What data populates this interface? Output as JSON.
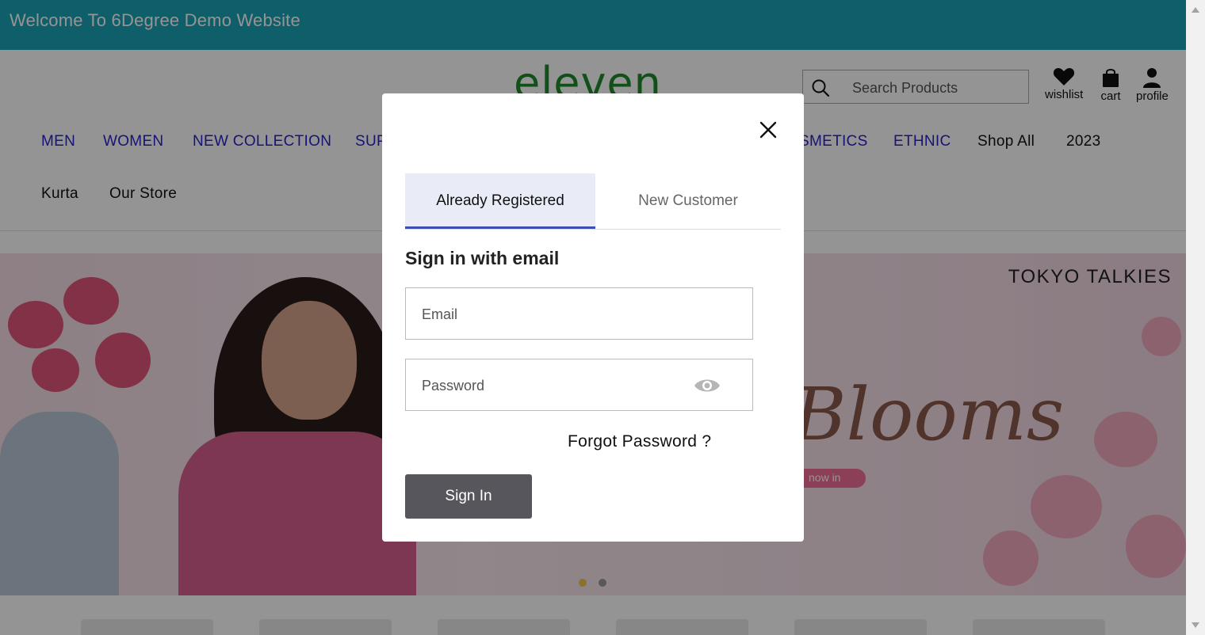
{
  "announcement": "Welcome To 6Degree Demo Website",
  "logo": "eleven",
  "search": {
    "placeholder": "Search Products"
  },
  "header_icons": {
    "wishlist": "wishlist",
    "cart": "cart",
    "profile": "profile"
  },
  "nav": {
    "items": [
      "MEN",
      "WOMEN",
      "NEW COLLECTION",
      "SUP",
      "SMETICS",
      "ETHNIC",
      "Shop All",
      "2023",
      "Kurta",
      "Our Store"
    ]
  },
  "banner": {
    "brand": "TOKYO TALKIES",
    "headline": "Blooms",
    "cta": "now in"
  },
  "carousel": {
    "slides": 2,
    "active_index": 0,
    "active_color": "#f0c44b",
    "inactive_color": "#999999"
  },
  "modal": {
    "tabs": [
      "Already Registered",
      "New Customer"
    ],
    "active_tab": "Already Registered",
    "heading": "Sign in with email",
    "email_placeholder": "Email",
    "password_placeholder": "Password",
    "forgot": "Forgot Password ?",
    "submit": "Sign In"
  },
  "colors": {
    "announcement_bg": "#1ba4b7",
    "logo": "#1e8a2a",
    "nav_link": "#2a22c8",
    "tab_active_underline": "#3d4fb0",
    "button_bg": "#56565c"
  }
}
